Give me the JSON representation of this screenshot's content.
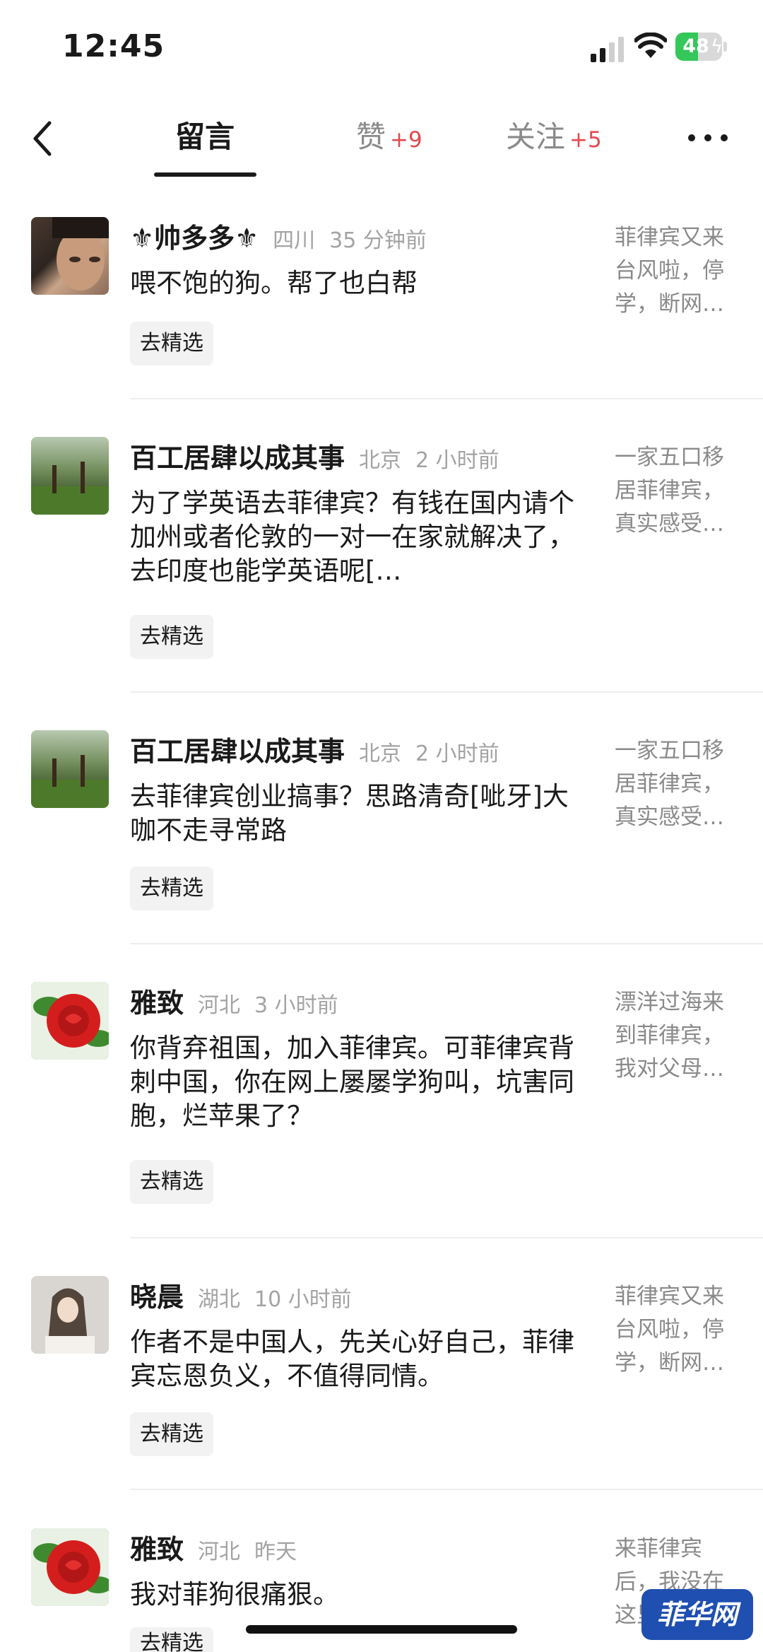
{
  "status_bar": {
    "time": "12:45",
    "battery": "48",
    "battery_level": 0.48
  },
  "nav": {
    "tabs": [
      {
        "label": "留言",
        "count": ""
      },
      {
        "label": "赞",
        "count": "+9"
      },
      {
        "label": "关注",
        "count": "+5"
      }
    ]
  },
  "comments": [
    {
      "name": "⚜帅多多⚜",
      "location": "四川",
      "time": "35 分钟前",
      "text": "喂不饱的狗。帮了也白帮",
      "action": "去精选",
      "article": "菲律宾又来台风啦，停学，断网…"
    },
    {
      "name": "百工居肆以成其事",
      "location": "北京",
      "time": "2 小时前",
      "text": "为了学英语去菲律宾？有钱在国内请个加州或者伦敦的一对一在家就解决了，去印度也能学英语呢[…",
      "action": "去精选",
      "article": "一家五口移居菲律宾，真实感受…"
    },
    {
      "name": "百工居肆以成其事",
      "location": "北京",
      "time": "2 小时前",
      "text": "去菲律宾创业搞事？思路清奇[呲牙]大咖不走寻常路",
      "action": "去精选",
      "article": "一家五口移居菲律宾，真实感受…"
    },
    {
      "name": "雅致",
      "location": "河北",
      "time": "3 小时前",
      "text": "你背弃祖国，加入菲律宾。可菲律宾背刺中国，你在网上屡屡学狗叫，坑害同胞，烂苹果了？",
      "action": "去精选",
      "article": "漂洋过海来到菲律宾，我对父母…"
    },
    {
      "name": "晓晨",
      "location": "湖北",
      "time": "10 小时前",
      "text": "作者不是中国人，先关心好自己，菲律宾忘恩负义，不值得同情。",
      "action": "去精选",
      "article": "菲律宾又来台风啦，停学，断网…"
    },
    {
      "name": "雅致",
      "location": "河北",
      "time": "昨天",
      "text": "我对菲狗很痛狠。",
      "action": "去精选",
      "article": "来菲律宾后，我没在这里…"
    }
  ],
  "watermark": "菲华网",
  "colors": {
    "accent_red": "#e5484d",
    "text_gray": "#a3a3a3",
    "battery_green": "#34c759"
  }
}
